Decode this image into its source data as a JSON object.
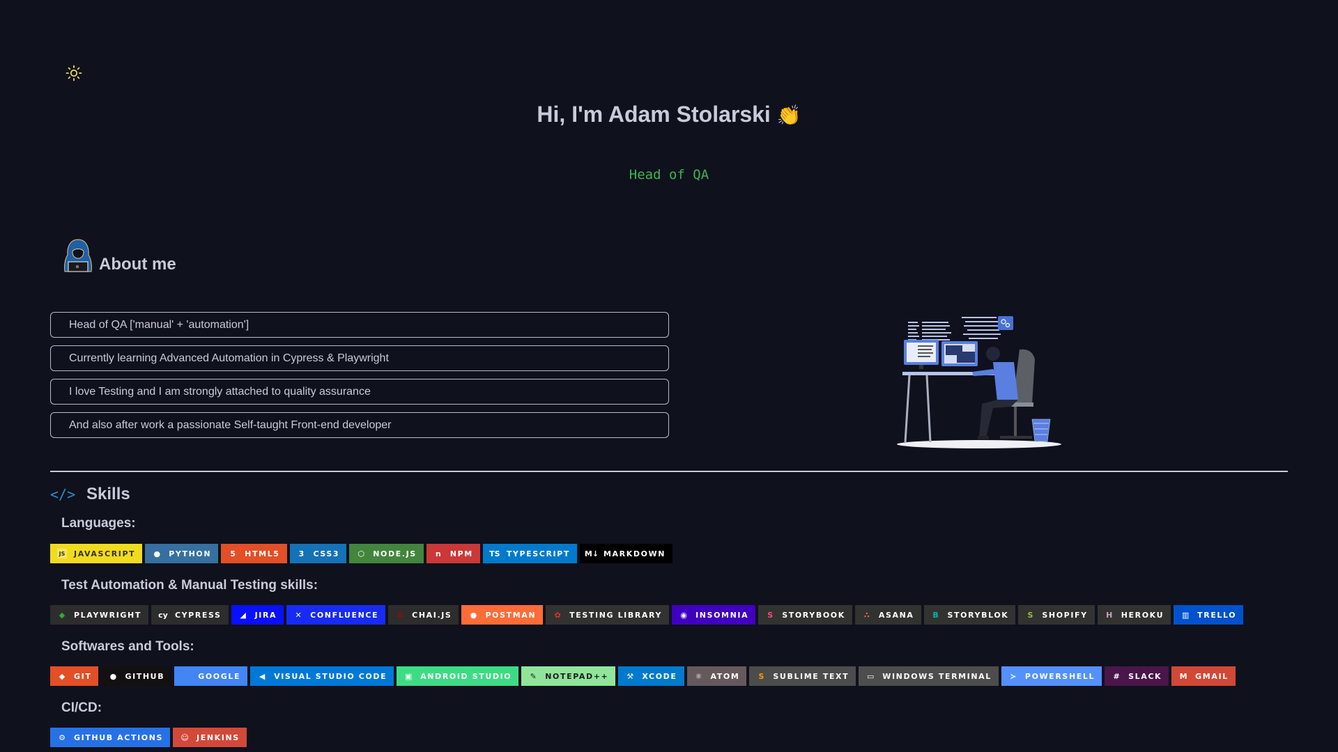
{
  "theme_toggle": {
    "icon": "sun-icon",
    "color": "#e8dc4f"
  },
  "hero": {
    "title": "Hi, I'm Adam Stolarski",
    "wave_emoji": "👏",
    "subtitle": "Head of QA"
  },
  "about": {
    "heading": "About me",
    "icon": "hacker-avatar-icon",
    "items": [
      "Head of QA ['manual' + 'automation']",
      "Currently learning Advanced Automation in Cypress & Playwright",
      "I love Testing and I am strongly attached to quality assurance",
      "And also after work a passionate Self-taught Front-end developer"
    ],
    "illustration": "developer-at-desk-illustration"
  },
  "skills": {
    "heading": "Skills",
    "icon": "code-icon",
    "categories": [
      {
        "title": "Languages:",
        "badges": [
          {
            "label": "JAVASCRIPT",
            "bg": "#f0db1e",
            "fg": "#323330",
            "icon": "js"
          },
          {
            "label": "PYTHON",
            "bg": "#3670a0",
            "fg": "#ffffff",
            "icon": "python"
          },
          {
            "label": "HTML5",
            "bg": "#e34f26",
            "fg": "#ffffff",
            "icon": "html5"
          },
          {
            "label": "CSS3",
            "bg": "#1572b6",
            "fg": "#ffffff",
            "icon": "css3"
          },
          {
            "label": "NODE.JS",
            "bg": "#43853d",
            "fg": "#ffffff",
            "icon": "nodejs"
          },
          {
            "label": "NPM",
            "bg": "#cb3837",
            "fg": "#ffffff",
            "icon": "npm"
          },
          {
            "label": "TYPESCRIPT",
            "bg": "#007acc",
            "fg": "#ffffff",
            "icon": "typescript"
          },
          {
            "label": "MARKDOWN",
            "bg": "#000000",
            "fg": "#ffffff",
            "icon": "markdown"
          }
        ]
      },
      {
        "title": "Test Automation & Manual Testing skills:",
        "badges": [
          {
            "label": "PLAYWRIGHT",
            "bg": "#2d2d2d",
            "fg": "#ffffff",
            "icon": "playwright"
          },
          {
            "label": "CYPRESS",
            "bg": "#2d2d2d",
            "fg": "#ffffff",
            "icon": "cypress"
          },
          {
            "label": "JIRA",
            "bg": "#0a0fff",
            "fg": "#ffffff",
            "icon": "jira"
          },
          {
            "label": "CONFLUENCE",
            "bg": "#172bf4",
            "fg": "#ffffff",
            "icon": "confluence"
          },
          {
            "label": "CHAI.JS",
            "bg": "#2d2d2d",
            "fg": "#ffffff",
            "icon": "chai"
          },
          {
            "label": "POSTMAN",
            "bg": "#ff6c37",
            "fg": "#ffffff",
            "icon": "postman"
          },
          {
            "label": "TESTING LIBRARY",
            "bg": "#323330",
            "fg": "#ffffff",
            "icon": "testing-library"
          },
          {
            "label": "INSOMNIA",
            "bg": "#4000bf",
            "fg": "#ffffff",
            "icon": "insomnia"
          },
          {
            "label": "STORYBOOK",
            "bg": "#323330",
            "fg": "#ffffff",
            "icon": "storybook"
          },
          {
            "label": "ASANA",
            "bg": "#323330",
            "fg": "#ffffff",
            "icon": "asana"
          },
          {
            "label": "STORYBLOK",
            "bg": "#323330",
            "fg": "#ffffff",
            "icon": "storyblok"
          },
          {
            "label": "SHOPIFY",
            "bg": "#323330",
            "fg": "#ffffff",
            "icon": "shopify"
          },
          {
            "label": "HEROKU",
            "bg": "#323330",
            "fg": "#ffffff",
            "icon": "heroku"
          },
          {
            "label": "TRELLO",
            "bg": "#0052cc",
            "fg": "#ffffff",
            "icon": "trello"
          }
        ]
      },
      {
        "title": "Softwares and Tools:",
        "badges": [
          {
            "label": "GIT",
            "bg": "#e34f26",
            "fg": "#ffffff",
            "icon": "git"
          },
          {
            "label": "GITHUB",
            "bg": "#121011",
            "fg": "#ffffff",
            "icon": "github"
          },
          {
            "label": "GOOGLE",
            "bg": "#4285f4",
            "fg": "#ffffff",
            "icon": "google"
          },
          {
            "label": "VISUAL STUDIO CODE",
            "bg": "#0078d7",
            "fg": "#ffffff",
            "icon": "vscode"
          },
          {
            "label": "ANDROID STUDIO",
            "bg": "#3ddc84",
            "fg": "#ffffff",
            "icon": "android"
          },
          {
            "label": "NOTEPAD++",
            "bg": "#90e59a",
            "fg": "#1c1c1c",
            "icon": "notepad"
          },
          {
            "label": "XCODE",
            "bg": "#007acc",
            "fg": "#ffffff",
            "icon": "xcode"
          },
          {
            "label": "ATOM",
            "bg": "#66595c",
            "fg": "#ffffff",
            "icon": "atom"
          },
          {
            "label": "SUBLIME TEXT",
            "bg": "#4c4c4c",
            "fg": "#ffffff",
            "icon": "sublime"
          },
          {
            "label": "WINDOWS TERMINAL",
            "bg": "#4d4d4d",
            "fg": "#ffffff",
            "icon": "terminal"
          },
          {
            "label": "POWERSHELL",
            "bg": "#5391fe",
            "fg": "#ffffff",
            "icon": "powershell"
          },
          {
            "label": "SLACK",
            "bg": "#4a154b",
            "fg": "#ffffff",
            "icon": "slack"
          },
          {
            "label": "GMAIL",
            "bg": "#d14836",
            "fg": "#ffffff",
            "icon": "gmail"
          }
        ]
      },
      {
        "title": "CI/CD:",
        "badges": [
          {
            "label": "GITHUB ACTIONS",
            "bg": "#2671e5",
            "fg": "#ffffff",
            "icon": "github-actions"
          },
          {
            "label": "JENKINS",
            "bg": "#d24939",
            "fg": "#ffffff",
            "icon": "jenkins"
          }
        ]
      }
    ]
  }
}
